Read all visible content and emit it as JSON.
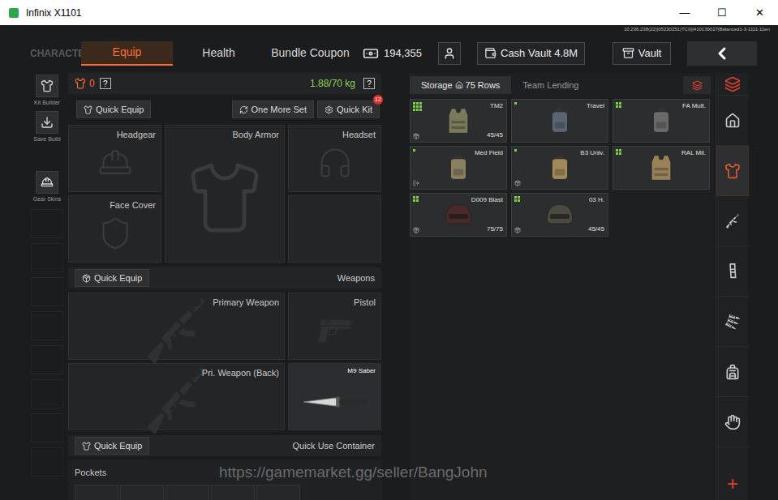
{
  "window": {
    "title": "Infinix X1101",
    "controls": [
      "—",
      "☐",
      "✕"
    ]
  },
  "build_info": "10.236.238(22)|05230251(TC0)|410139027|Balanced1-3-1111-11en",
  "nav": {
    "section": "CHARACTER",
    "tabs": [
      {
        "label": "Equip",
        "selected": true
      },
      {
        "label": "Health",
        "selected": false
      },
      {
        "label": "Bundle Coupon",
        "selected": false
      }
    ],
    "money": "194,355",
    "cash_vault": "Cash Vault 4.8M",
    "vault": "Vault"
  },
  "sidebar": [
    {
      "label": "Kit Builder"
    },
    {
      "label": "Save Build"
    },
    {
      "label": "Gear Skins"
    }
  ],
  "equip": {
    "armor_count": "0",
    "help": "?",
    "weight": "1.88/70 kg",
    "quick_equip": "Quick Equip",
    "one_more_set": "One More Set",
    "quick_kit": "Quick Kit",
    "quick_kit_badge": "12",
    "gear_slots": [
      {
        "label": "Headgear"
      },
      {
        "label": "Body Armor"
      },
      {
        "label": "Headset"
      },
      {
        "label": "Face Cover"
      }
    ],
    "weapons_title": "Weapons",
    "weapon_slots": [
      {
        "label": "Primary Weapon",
        "filled": false
      },
      {
        "label": "Pistol",
        "filled": false
      },
      {
        "label": "Pri. Weapon (Back)",
        "filled": false
      },
      {
        "label": "M9 Saber",
        "filled": true
      }
    ],
    "quick_use_title": "Quick Use Container",
    "pockets_title": "Pockets"
  },
  "storage": {
    "tabs": [
      {
        "label": "Storage",
        "rows": "75 Rows",
        "selected": true
      },
      {
        "label": "Team Lending",
        "rows": "",
        "selected": false
      }
    ],
    "items": [
      {
        "name": "TM2",
        "durability": "45/45",
        "kind": "vest",
        "color": "#7a7a5a",
        "size_marks": 9,
        "corner": "box"
      },
      {
        "name": "Travel",
        "durability": "",
        "kind": "backpack",
        "color": "#5a6472",
        "size_marks": 1,
        "corner": "none"
      },
      {
        "name": "FA Mult.",
        "durability": "",
        "kind": "backpack",
        "color": "#6a6a6a",
        "size_marks": 4,
        "corner": "none"
      },
      {
        "name": "Med Field",
        "durability": "",
        "kind": "backpack",
        "color": "#8a8060",
        "size_marks": 1,
        "corner": "exit"
      },
      {
        "name": "B3 Univ.",
        "durability": "",
        "kind": "backpack",
        "color": "#a08a5a",
        "size_marks": 1,
        "corner": "box"
      },
      {
        "name": "RAL Mil.",
        "durability": "",
        "kind": "vest",
        "color": "#9a8258",
        "size_marks": 4,
        "corner": "none"
      },
      {
        "name": "D009 Blast",
        "durability": "75/75",
        "kind": "helmet",
        "color": "#4a2a28",
        "size_marks": 4,
        "corner": "box"
      },
      {
        "name": "03 H.",
        "durability": "45/45",
        "kind": "helmet",
        "color": "#4a4a40",
        "size_marks": 4,
        "corner": "box"
      }
    ]
  },
  "right_nav": {
    "items": [
      {
        "selected": false,
        "color": "#e0402a"
      },
      {
        "selected": false,
        "color": "#c8c8c8"
      },
      {
        "selected": true,
        "color": "#e05a2a"
      },
      {
        "selected": false,
        "color": "#c8c8c8"
      },
      {
        "selected": false,
        "color": "#c8c8c8"
      },
      {
        "selected": false,
        "color": "#c8c8c8"
      },
      {
        "selected": false,
        "color": "#c8c8c8"
      },
      {
        "selected": false,
        "color": "#c8c8c8"
      }
    ],
    "add": "+"
  },
  "watermark": "https://gamemarket.gg/seller/BangJohn"
}
